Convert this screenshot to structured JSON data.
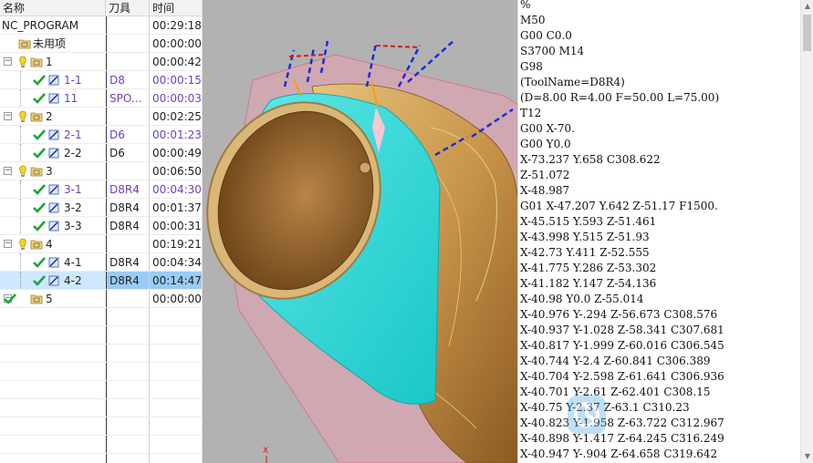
{
  "navigator": {
    "columns": {
      "name": "名称",
      "tool": "刀具",
      "time": "时间"
    },
    "rows": [
      {
        "name": "NC_PROGRAM",
        "tool": "",
        "time": "00:29:18",
        "color": "dark",
        "icon": "none",
        "level": 0
      },
      {
        "name": "未用项",
        "tool": "",
        "time": "00:00:00",
        "color": "dark",
        "icon": "folder-icon",
        "level": 1
      },
      {
        "name": "1",
        "tool": "",
        "time": "00:00:42",
        "color": "dark",
        "icon": "program-group-icon",
        "level": 1
      },
      {
        "name": "1-1",
        "tool": "D8",
        "time": "00:00:15",
        "color": "purple",
        "icon": "operation-icon",
        "level": 2
      },
      {
        "name": "11",
        "tool": "SPO...",
        "time": "00:00:03",
        "color": "purple",
        "icon": "operation-icon",
        "level": 2
      },
      {
        "name": "2",
        "tool": "",
        "time": "00:02:25",
        "color": "dark",
        "icon": "program-group-icon",
        "level": 1
      },
      {
        "name": "2-1",
        "tool": "D6",
        "time": "00:01:23",
        "color": "purple",
        "icon": "operation-icon",
        "level": 2
      },
      {
        "name": "2-2",
        "tool": "D6",
        "time": "00:00:49",
        "color": "dark",
        "icon": "operation-icon",
        "level": 2
      },
      {
        "name": "3",
        "tool": "",
        "time": "00:06:50",
        "color": "dark",
        "icon": "program-group-icon",
        "level": 1
      },
      {
        "name": "3-1",
        "tool": "D8R4",
        "time": "00:04:30",
        "color": "purple",
        "icon": "operation-icon",
        "level": 2
      },
      {
        "name": "3-2",
        "tool": "D8R4",
        "time": "00:01:37",
        "color": "dark",
        "icon": "operation-icon",
        "level": 2
      },
      {
        "name": "3-3",
        "tool": "D8R4",
        "time": "00:00:31",
        "color": "dark",
        "icon": "operation-icon",
        "level": 2
      },
      {
        "name": "4",
        "tool": "",
        "time": "00:19:21",
        "color": "dark",
        "icon": "program-group-icon",
        "level": 1
      },
      {
        "name": "4-1",
        "tool": "D8R4",
        "time": "00:04:34",
        "color": "dark",
        "icon": "operation-icon",
        "level": 2
      },
      {
        "name": "4-2",
        "tool": "D8R4",
        "time": "00:14:47",
        "color": "dark",
        "icon": "operation-icon",
        "level": 2,
        "selected": true
      },
      {
        "name": "5",
        "tool": "",
        "time": "00:00:00",
        "color": "dark",
        "icon": "program-group-icon",
        "level": 1
      }
    ]
  },
  "viewport": {
    "axis_label": "X"
  },
  "nc_code": {
    "lines": [
      "%",
      "M50",
      "G00 C0.0",
      "S3700 M14",
      "G98",
      "(ToolName=D8R4)",
      "(D=8.00 R=4.00 F=50.00 L=75.00)",
      "T12",
      "G00 X-70.",
      "G00 Y0.0",
      "X-73.237 Y.658 C308.622",
      "Z-51.072",
      "X-48.987",
      "G01 X-47.207 Y.642 Z-51.17 F1500.",
      "X-45.515 Y.593 Z-51.461",
      "X-43.998 Y.515 Z-51.93",
      "X-42.73 Y.411 Z-52.555",
      "X-41.775 Y.286 Z-53.302",
      "X-41.182 Y.147 Z-54.136",
      "X-40.98 Y0.0 Z-55.014",
      "X-40.976 Y-.294 Z-56.673 C308.576",
      "X-40.937 Y-1.028 Z-58.341 C307.681",
      "X-40.817 Y-1.999 Z-60.016 C306.545",
      "X-40.744 Y-2.4 Z-60.841 C306.389",
      "X-40.704 Y-2.598 Z-61.641 C306.936",
      "X-40.701 Y-2.61 Z-62.401 C308.15",
      "X-40.75 Y-2.37 Z-63.1 C310.23",
      "X-40.823 Y-1.958 Z-63.722 C312.967",
      "X-40.898 Y-1.417 Z-64.245 C316.249",
      "X-40.947 Y-.904 Z-64.658 C319.642"
    ]
  },
  "colors": {
    "purple": "#6f3fbf",
    "selected": "#99ccf5",
    "teal": "#3ad6d6",
    "gold": "#c9964a"
  }
}
